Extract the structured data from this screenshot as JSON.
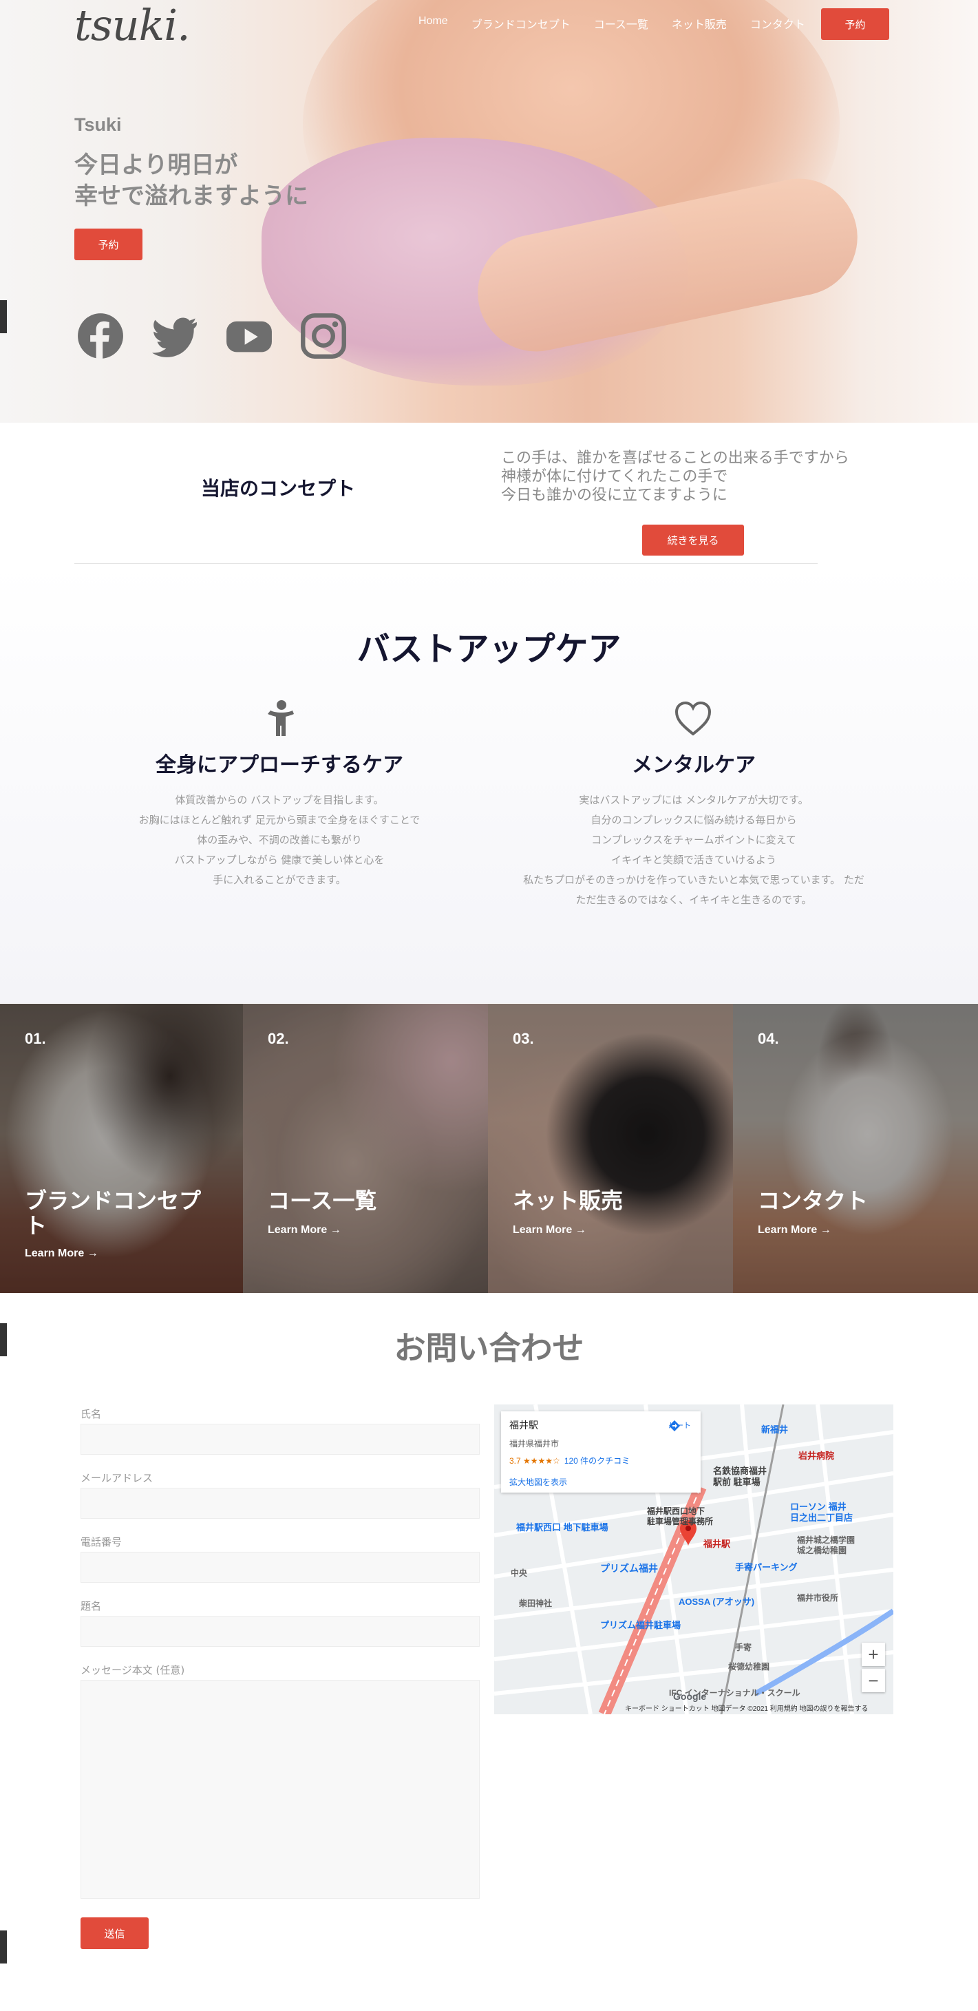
{
  "header": {
    "logo": "tsuki.",
    "nav": [
      "Home",
      "ブランドコンセプト",
      "コース一覧",
      "ネット販売",
      "コンタクト"
    ],
    "reserve_label": "予約"
  },
  "hero": {
    "brand": "Tsuki",
    "title_line1": "今日より明日が",
    "title_line2": "幸せで溢れますように",
    "reserve_label": "予約",
    "social_icons": [
      "facebook-icon",
      "twitter-icon",
      "youtube-icon",
      "instagram-icon"
    ]
  },
  "concept": {
    "title": "当店のコンセプト",
    "text_line1": "この手は、誰かを喜ばせることの出来る手ですから",
    "text_line2": "神様が体に付けてくれたこの手で",
    "text_line3": "今日も誰かの役に立てますように",
    "more_label": "続きを見る"
  },
  "care": {
    "title": "バストアップケア",
    "left": {
      "icon": "person-icon",
      "title": "全身にアプローチするケア",
      "lines": [
        "体質改善からの バストアップを目指します。",
        "お胸にはほとんど触れず 足元から頭まで全身をほぐすことで",
        "体の歪みや、不調の改善にも繋がり",
        "バストアップしながら 健康で美しい体と心を",
        "手に入れることができます。"
      ]
    },
    "right": {
      "icon": "heart-icon",
      "title": "メンタルケア",
      "lines": [
        "実はバストアップには メンタルケアが大切です。",
        "自分のコンプレックスに悩み続ける毎日から",
        "コンプレックスをチャームポイントに変えて",
        "イキイキと笑顔で活きていけるよう",
        "私たちプロがそのきっかけを作っていきたいと本気で思っています。 ただ",
        "ただ生きるのではなく、イキイキと生きるのです。"
      ]
    }
  },
  "panels": [
    {
      "num": "01.",
      "title_line1": "ブランドコンセプ",
      "title_line2": "ト",
      "more": "Learn More →"
    },
    {
      "num": "02.",
      "title_line1": "コース一覧",
      "title_line2": "",
      "more": "Learn More →"
    },
    {
      "num": "03.",
      "title_line1": "ネット販売",
      "title_line2": "",
      "more": "Learn More →"
    },
    {
      "num": "04.",
      "title_line1": "コンタクト",
      "title_line2": "",
      "more": "Learn More →"
    }
  ],
  "contact": {
    "title": "お問い合わせ",
    "fields": {
      "name": "氏名",
      "email": "メールアドレス",
      "phone": "電話番号",
      "subject": "題名",
      "message": "メッセージ本文 (任意)"
    },
    "send_label": "送信"
  },
  "map": {
    "place": "福井駅",
    "address": "福井県福井市",
    "rating": "3.7 ★★★★☆",
    "reviews": "120 件のクチコミ",
    "larger_map": "拡大地図を表示",
    "route": "ルート",
    "labels": [
      "新福井",
      "名鉄協商福井",
      "駅前 駐車場",
      "岩井病院",
      "福井駅西口 地下駐車場",
      "福井駅西口地下",
      "駐車場管理事務所",
      "ローソン 福井",
      "日之出二丁目店",
      "福井駅",
      "福井城之橋学園",
      "城之橋幼稚園",
      "プリズム福井",
      "手寄パーキング",
      "AOSSA (アオッサ)",
      "福井市役所",
      "柴田神社",
      "プリズム福井駐車場",
      "桜德幼稚園",
      "中央",
      "手寄",
      "IFC インターナショナル・スクール"
    ],
    "footer": "キーボード ショートカット   地図データ ©2021   利用規約   地図の誤りを報告する",
    "zoom_in": "+",
    "zoom_out": "−",
    "google": "Google"
  },
  "colors": {
    "accent": "#e14b3b",
    "heading": "#151630",
    "muted": "#9a9a9a"
  }
}
